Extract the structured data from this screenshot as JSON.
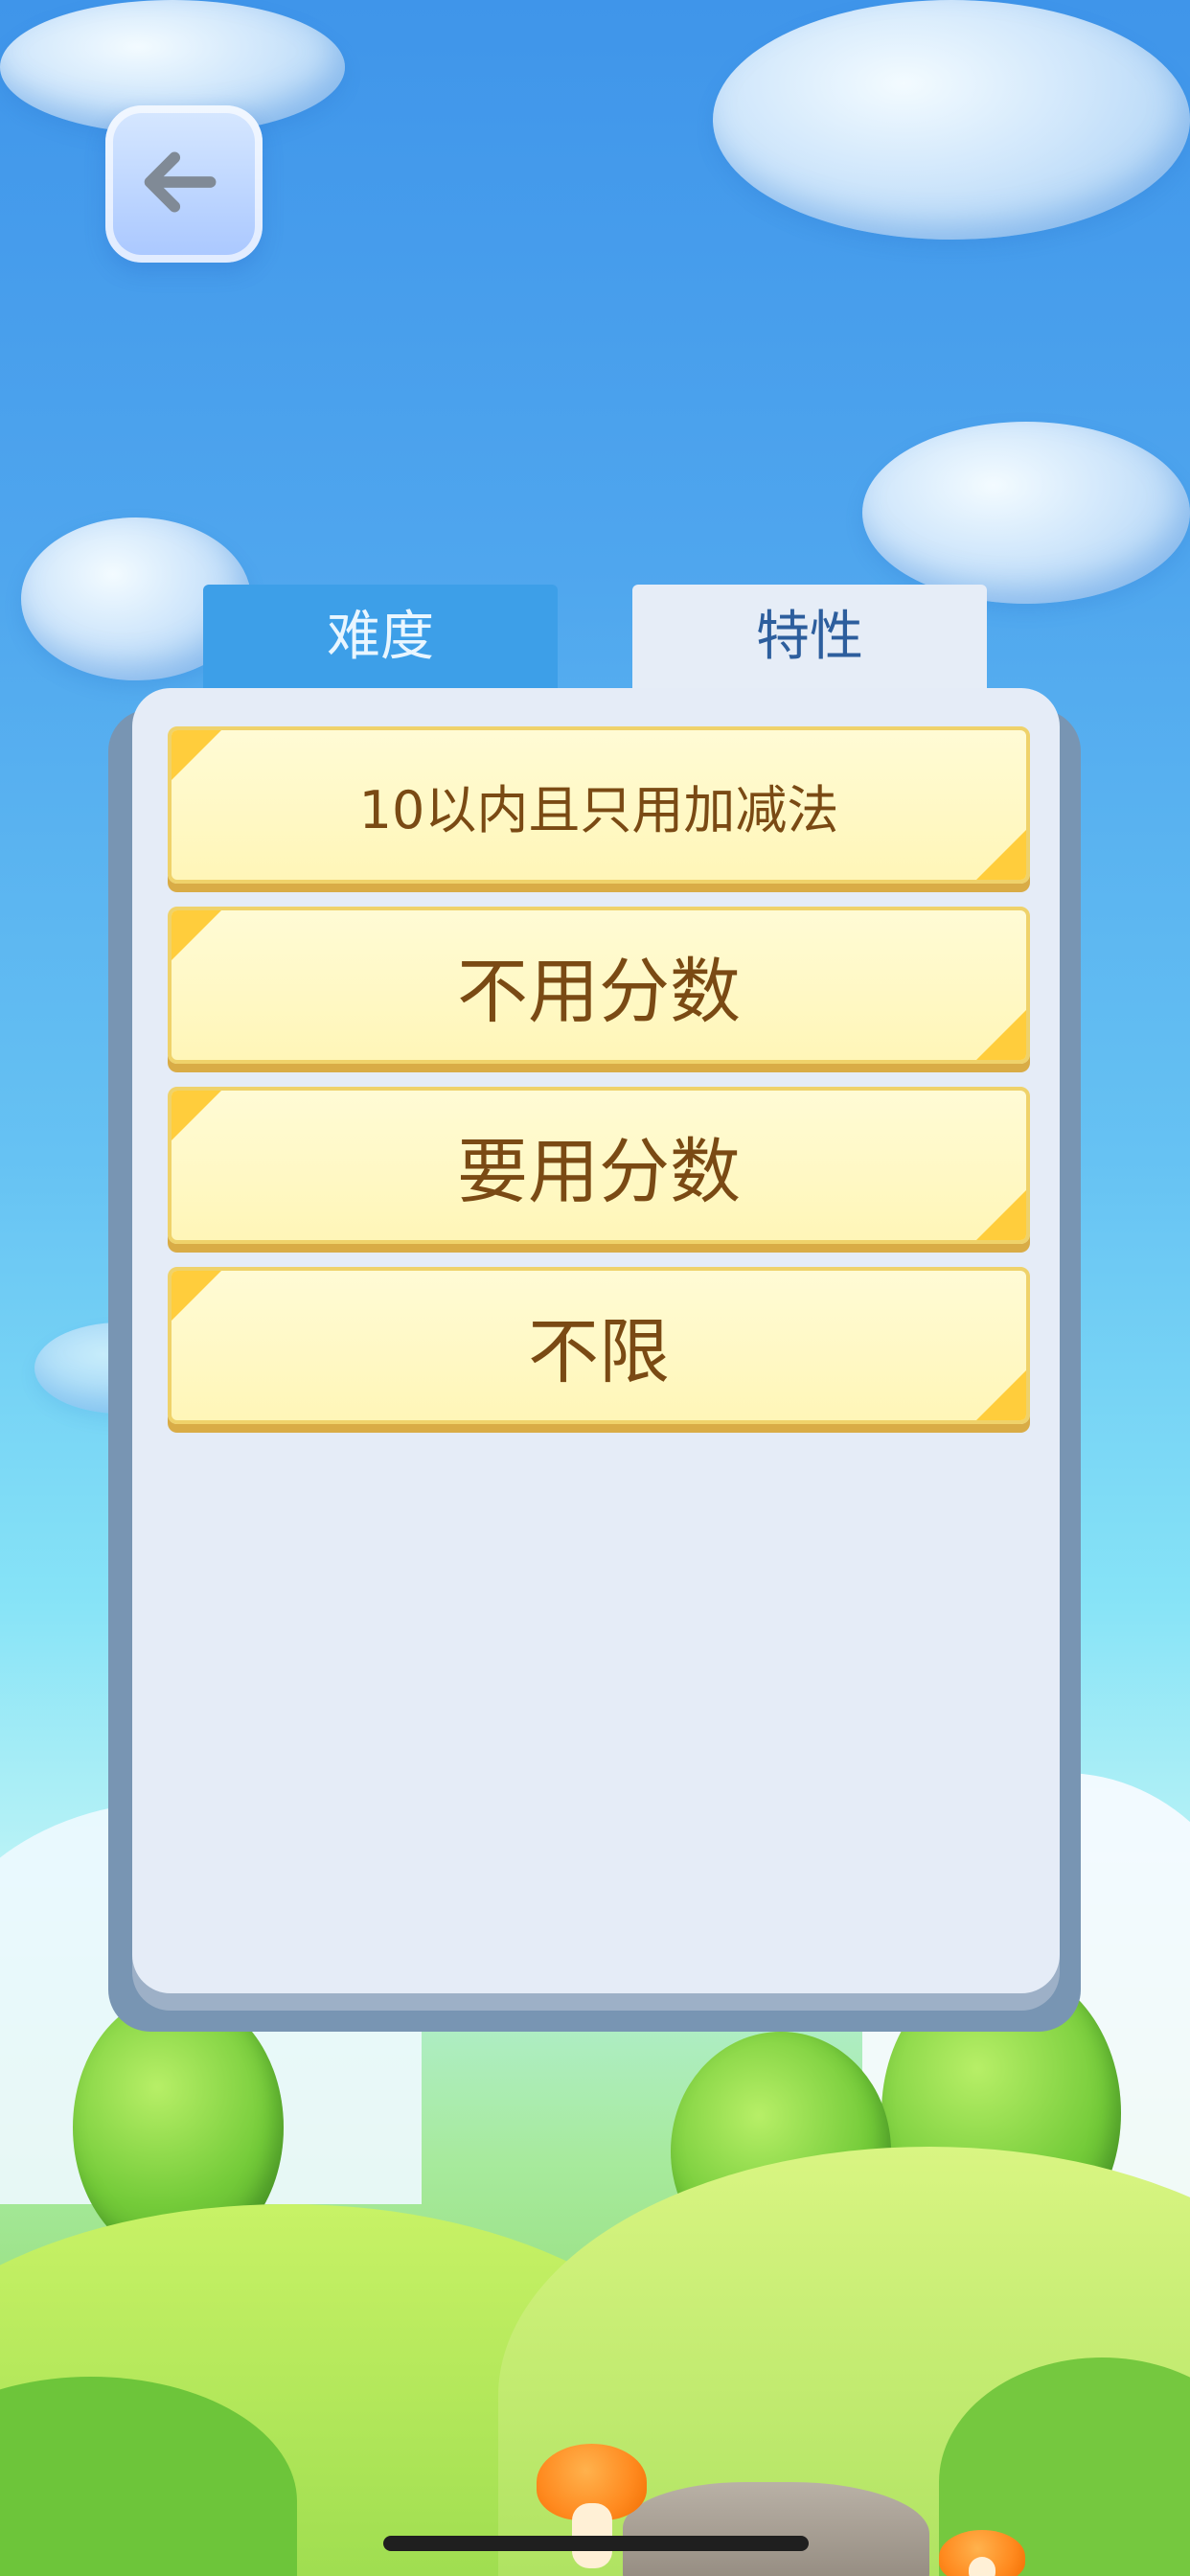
{
  "tabs": [
    {
      "label": "难度"
    },
    {
      "label": "特性"
    }
  ],
  "options": [
    {
      "label": "10以内且只用加减法"
    },
    {
      "label": "不用分数"
    },
    {
      "label": "要用分数"
    },
    {
      "label": "不限"
    }
  ],
  "icons": {
    "back": "back-arrow-icon"
  },
  "colors": {
    "sky_top": "#3f95ea",
    "tab_active": "#3d9fe8",
    "tab_inactive": "#e6edf7",
    "panel": "#e5ecf7",
    "option_bg": "#fffbd5",
    "option_text": "#7a4a14",
    "option_accent": "#ffcd3c"
  }
}
